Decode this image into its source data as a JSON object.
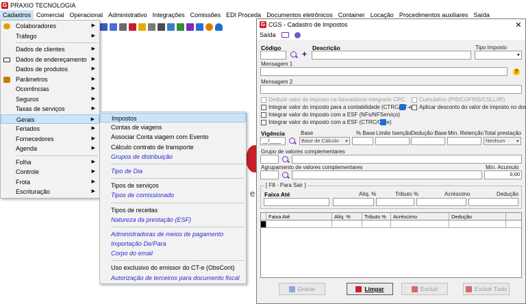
{
  "app": {
    "logo": "G",
    "title": "PRAXIO TECNOLOGIA"
  },
  "menubar": [
    "Cadastros",
    "Comercial",
    "Operacional",
    "Administrativo",
    "Integrações",
    "Comissões",
    "EDI Proceda",
    "Documentos eletrônicos",
    "Container",
    "Locação",
    "Procedimentos auxiliares",
    "Saída"
  ],
  "dropdown": {
    "items": [
      {
        "label": "Colaboradores",
        "arrow": "▶"
      },
      {
        "label": "Tráfego",
        "arrow": "▶"
      },
      {
        "label": "Dados de clientes",
        "arrow": "▶"
      },
      {
        "label": "Dados de endereçamento",
        "arrow": "▶"
      },
      {
        "label": "Dados de produtos",
        "arrow": "▶"
      },
      {
        "label": "Parâmetros",
        "arrow": "▶"
      },
      {
        "label": "Ocorrências",
        "arrow": "▶"
      },
      {
        "label": "Seguros",
        "arrow": "▶"
      },
      {
        "label": "Taxas de serviços",
        "arrow": "▶"
      },
      {
        "label": "Gerais",
        "arrow": "▶"
      },
      {
        "label": "Feriados",
        "arrow": "▶"
      },
      {
        "label": "Fornecedores",
        "arrow": "▶"
      },
      {
        "label": "Agenda",
        "arrow": "▶"
      },
      {
        "label": "Folha",
        "arrow": "▶"
      },
      {
        "label": "Controle",
        "arrow": "▶"
      },
      {
        "label": "Frota",
        "arrow": "▶"
      },
      {
        "label": "Escrituração",
        "arrow": "▶"
      }
    ]
  },
  "submenu": {
    "items": [
      "Impostos",
      "Contas de viagens",
      "Associar Conta viagem com Evento",
      "Cálculo contrato de transporte",
      "Grupos de distribuição",
      "Tipo de Dia",
      "Tipos de serviços",
      "Tipos de comissionado",
      "Tipos de receitas",
      "Natureza da prestação (ESF)",
      "Administradoras de meios de pagamento",
      "Importação De/Para",
      "Corpo do email",
      "Uso exclusivo do emissor do CT-e (ObsCont)",
      "Autorização de terceiros para documento fiscal"
    ]
  },
  "dialog": {
    "logo": "G",
    "title": "CGS - Cadastro de Impostos",
    "close": "✕",
    "menu_label": "Saída",
    "codigo_label": "Código",
    "plus": "+",
    "descricao_label": "Descrição",
    "tipo_imposto_label": "Tipo Imposto",
    "mensagem1_label": "Mensagem 1",
    "mensagem2_label": "Mensagem 2",
    "help": "?",
    "checkboxes": {
      "deduzir": "Deduzir valor do imposto na fatura/docto integrado CRC",
      "cumulativo": "Cumulativo (PIS/COFINS/CSLL/IR)",
      "contabilidade": "Integrar valor do imposto para a contabilidade (CTRC/CT-e)",
      "aplicar_desconto": "Aplicar desconto do valor de imposto no docto",
      "esf_nfs": "Integrar valor do imposto com a ESF (NFs/NFServiço)",
      "esf_ctrc": "Integrar valor do imposto com a ESF (CTRC/CT-e)"
    },
    "vigencia_label": "Vigência",
    "vigencia_value": "__/____",
    "base_label": "Base",
    "base_value": "Base de Cálculo",
    "pct_base_label": "% Base",
    "limite_isencao_label": "Limite Isenção",
    "deducao_base_label": "Dedução Base",
    "min_retencao_label": "Mín. Retenção",
    "total_prestacao_label": "Total prestação",
    "total_prestacao_value": "Nenhum",
    "grupo_label": "Grupo de valores complementares",
    "agrup_label": "Agrupamento de valores complementares",
    "min_acumulo_label": "Mín. Acumulo",
    "min_acumulo_value": "0,00",
    "f8_label": "[ F8 - Para Sair ]",
    "faixa_ate_label": "Faixa Até",
    "aliq_label": "Alíq. %",
    "tributo_label": "Tributo %",
    "acrescimo_label": "Acréscimo",
    "deducao_label": "Dedução",
    "grid_headers": [
      "Faixa Até",
      "Alíq. %",
      "Tributo %",
      "Acréscimo",
      "Dedução"
    ],
    "buttons": {
      "gravar": "Gravar",
      "limpar": "Limpar",
      "excluir": "Excluir",
      "excluir_tudo": "Excluir Tudo"
    }
  },
  "background_letter": "e",
  "colors": {
    "accent": "#c8202a",
    "highlight": "#cce4f7",
    "link": "#2a2ad0",
    "icon_purple": "#7b2cbf"
  }
}
